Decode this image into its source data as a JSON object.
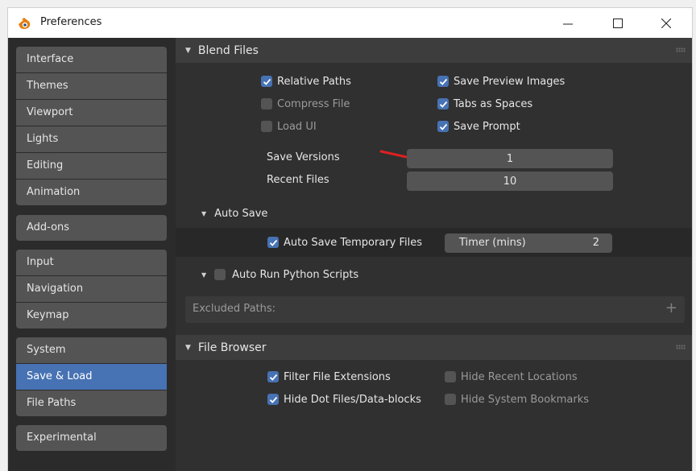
{
  "window": {
    "title": "Preferences",
    "minimize": "—",
    "maximize": "☐",
    "close": "✕"
  },
  "sidebar": {
    "groups": [
      [
        "Interface",
        "Themes",
        "Viewport",
        "Lights",
        "Editing",
        "Animation"
      ],
      [
        "Add-ons"
      ],
      [
        "Input",
        "Navigation",
        "Keymap"
      ],
      [
        "System",
        "Save & Load",
        "File Paths"
      ],
      [
        "Experimental"
      ]
    ],
    "active": "Save & Load"
  },
  "blend_files": {
    "header": "Blend Files",
    "relative_paths": "Relative Paths",
    "compress_file": "Compress File",
    "load_ui": "Load UI",
    "save_preview_images": "Save Preview Images",
    "tabs_as_spaces": "Tabs as Spaces",
    "save_prompt": "Save Prompt",
    "save_versions_label": "Save Versions",
    "save_versions_value": "1",
    "recent_files_label": "Recent Files",
    "recent_files_value": "10"
  },
  "auto_save": {
    "header": "Auto Save",
    "temp_files": "Auto Save Temporary Files",
    "timer_label": "Timer (mins)",
    "timer_value": "2"
  },
  "auto_run": {
    "header": "Auto Run Python Scripts",
    "excluded_paths": "Excluded Paths:",
    "add": "+"
  },
  "file_browser": {
    "header": "File Browser",
    "filter_ext": "Filter File Extensions",
    "hide_dot": "Hide Dot Files/Data-blocks",
    "hide_recent": "Hide Recent Locations",
    "hide_bookmarks": "Hide System Bookmarks"
  },
  "checkboxes": {
    "relative_paths": true,
    "compress_file": false,
    "load_ui": false,
    "save_preview_images": true,
    "tabs_as_spaces": true,
    "save_prompt": true,
    "auto_save_temp": true,
    "auto_run_python": false,
    "filter_file_extensions": true,
    "hide_dot_files": true,
    "hide_recent_locations": false,
    "hide_system_bookmarks": false
  },
  "colors": {
    "accent": "#4772b3",
    "annotation": "#e02020"
  },
  "icons": {
    "app": "blender-logo-icon",
    "checkmark": "checkmark-icon",
    "panel_expanded": "triangle-down-icon"
  }
}
